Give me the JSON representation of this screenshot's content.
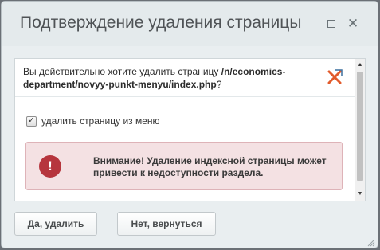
{
  "dialog": {
    "title": "Подтверждение удаления страницы",
    "question_prefix": "Вы действительно хотите удалить страницу",
    "page_path": "/n/economics-department/novyy-punkt-menyu/index.php",
    "question_suffix": "?",
    "checkbox_label": "удалить страницу из меню",
    "checkbox_checked": true,
    "warning_text": "Внимание! Удаление индексной страницы может привести к недоступности раздела.",
    "confirm_label": "Да, удалить",
    "cancel_label": "Нет, вернуться"
  },
  "icons": {
    "maximize": "maximize-icon",
    "close": "close-icon",
    "delete": "delete-page-icon",
    "warning": "warning-icon",
    "resize": "resize-grip-icon"
  },
  "colors": {
    "alert_bg": "#f4e1e3",
    "alert_icon": "#b6353d",
    "delete_icon": "#e25b2c"
  }
}
